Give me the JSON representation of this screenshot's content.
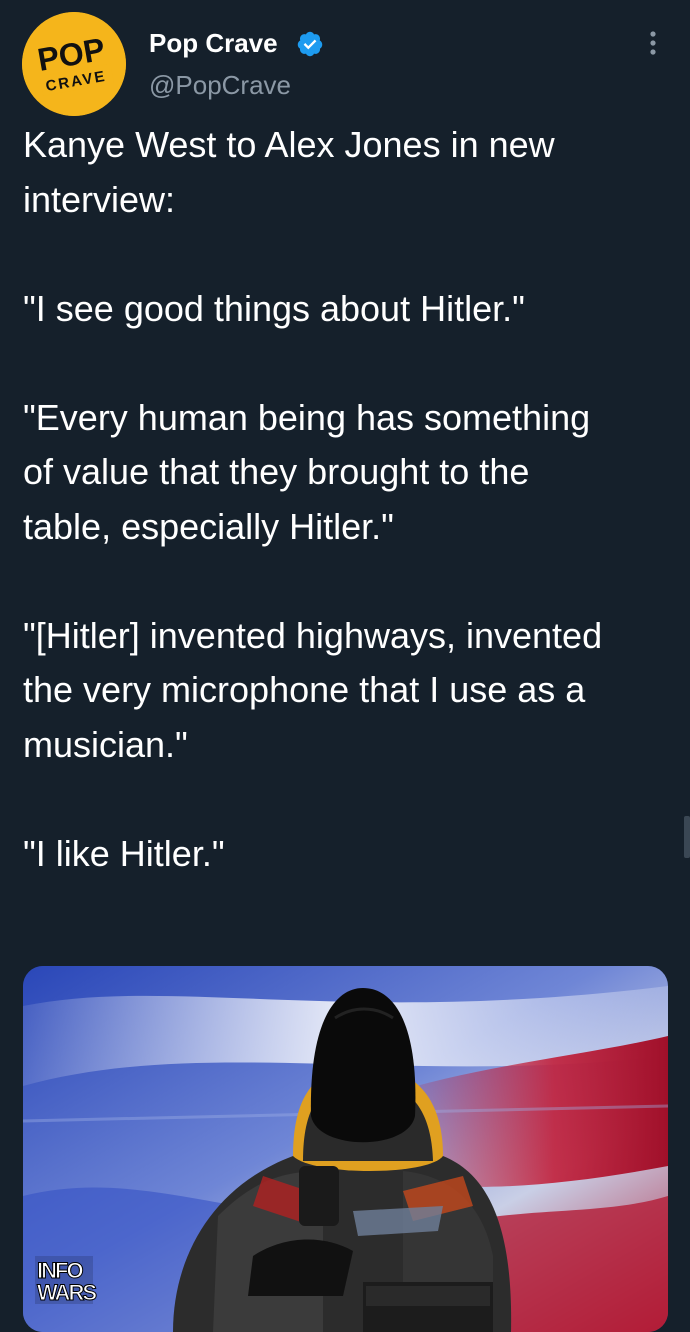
{
  "tweet": {
    "display_name": "Pop Crave",
    "handle": "@PopCrave",
    "verified_icon": "verified-badge-icon",
    "more_icon": "more-options-icon",
    "avatar": {
      "logo_top": "POP",
      "logo_bottom": "CRAVE"
    },
    "text": {
      "line1": "Kanye West to Alex Jones in new interview:",
      "quote1": "\"I see good things about Hitler.\"",
      "quote2": "\"Every human being has something of value that they brought to the table, especially Hitler.\"",
      "quote3": "\"[Hitler] invented highways, invented the very microphone that I use as a musician.\"",
      "quote4": "\"I like Hitler.\""
    },
    "media": {
      "watermark_line1": "INFO",
      "watermark_line2": "WARS"
    }
  },
  "colors": {
    "background": "#15202b",
    "text": "#ffffff",
    "secondary_text": "#8b98a5",
    "verified": "#1d9bf0",
    "avatar_bg": "#f5b51b"
  }
}
